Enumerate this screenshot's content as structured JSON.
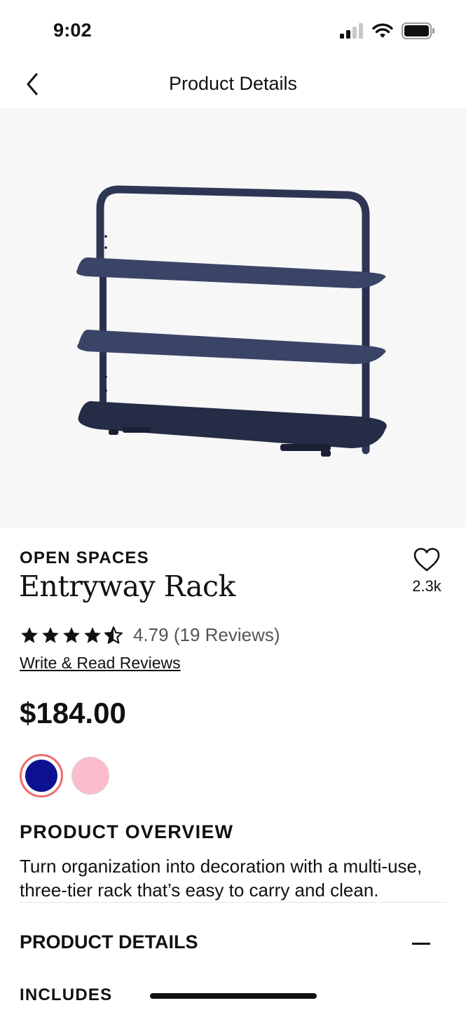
{
  "status": {
    "time": "9:02"
  },
  "nav": {
    "title": "Product Details"
  },
  "product": {
    "brand": "OPEN SPACES",
    "name": "Entryway Rack",
    "favorites_count": "2.3k",
    "rating_value": 4.79,
    "rating_text": "4.79 (19 Reviews)",
    "review_link": "Write & Read Reviews",
    "price": "$184.00",
    "image_icon": "entryway-rack-product-image",
    "swatches": [
      {
        "color": "#0b1190",
        "selected": true
      },
      {
        "color": "#fdbccb",
        "selected": false
      }
    ]
  },
  "overview": {
    "title": "PRODUCT OVERVIEW",
    "text": "Turn organization into decoration with a multi-use, three-tier rack that’s easy to carry and clean."
  },
  "details": {
    "title": "PRODUCT DETAILS"
  },
  "includes": {
    "title": "INCLUDES"
  },
  "colors": {
    "selected_ring": "#ee6b6b",
    "rack": "#2e3654",
    "hero_bg": "#f7f7f8"
  }
}
